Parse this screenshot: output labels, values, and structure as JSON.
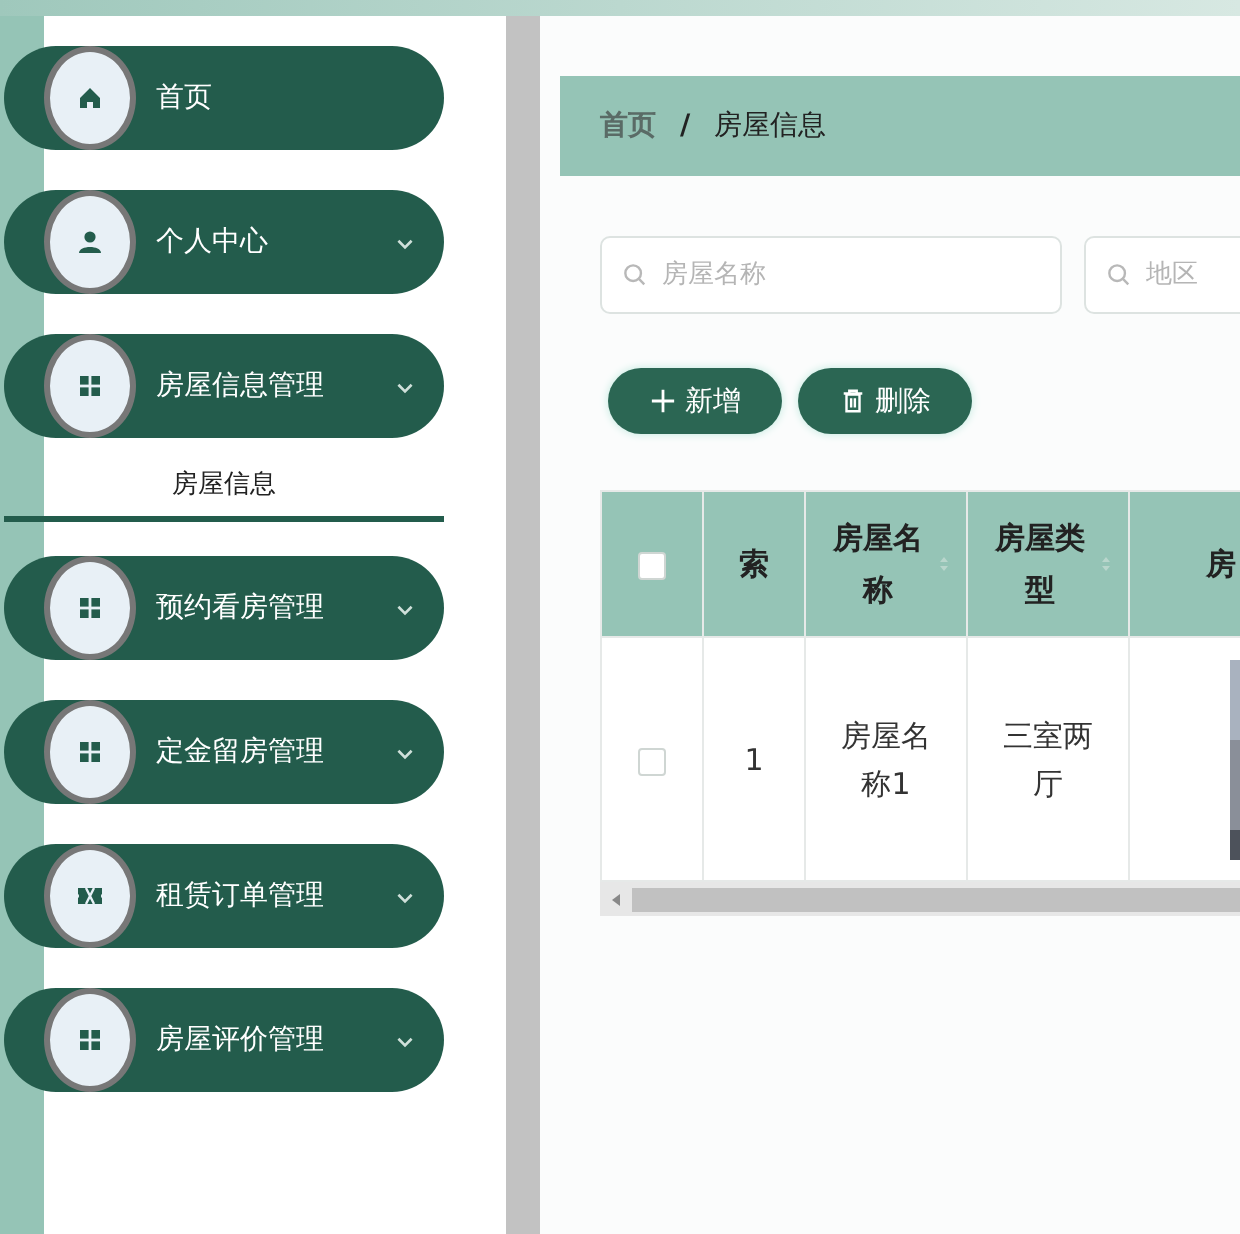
{
  "sidebar": {
    "items": [
      {
        "label": "首页",
        "expandable": false
      },
      {
        "label": "个人中心",
        "expandable": true
      },
      {
        "label": "房屋信息管理",
        "expandable": true,
        "children": [
          {
            "label": "房屋信息",
            "selected": true
          }
        ]
      },
      {
        "label": "预约看房管理",
        "expandable": true
      },
      {
        "label": "定金留房管理",
        "expandable": true
      },
      {
        "label": "租赁订单管理",
        "expandable": true
      },
      {
        "label": "房屋评价管理",
        "expandable": true
      }
    ]
  },
  "breadcrumb": [
    "首页",
    "房屋信息"
  ],
  "breadcrumb_separator": "/",
  "search": [
    {
      "placeholder": "房屋名称"
    },
    {
      "placeholder": "地区"
    }
  ],
  "buttons": [
    {
      "kind": "add",
      "label": "新增"
    },
    {
      "kind": "delete",
      "label": "删除"
    }
  ],
  "table": {
    "columns": [
      {
        "kind": "checkbox",
        "checked": false
      },
      {
        "label": "索"
      },
      {
        "label": "房屋名称",
        "sortable": true
      },
      {
        "label": "房屋类型",
        "sortable": true
      },
      {
        "label": "房"
      }
    ],
    "rows": [
      {
        "cells": [
          {
            "kind": "checkbox",
            "checked": false
          },
          "1",
          "房屋名称1",
          "三室两厅",
          {
            "kind": "picture"
          }
        ]
      }
    ]
  }
}
